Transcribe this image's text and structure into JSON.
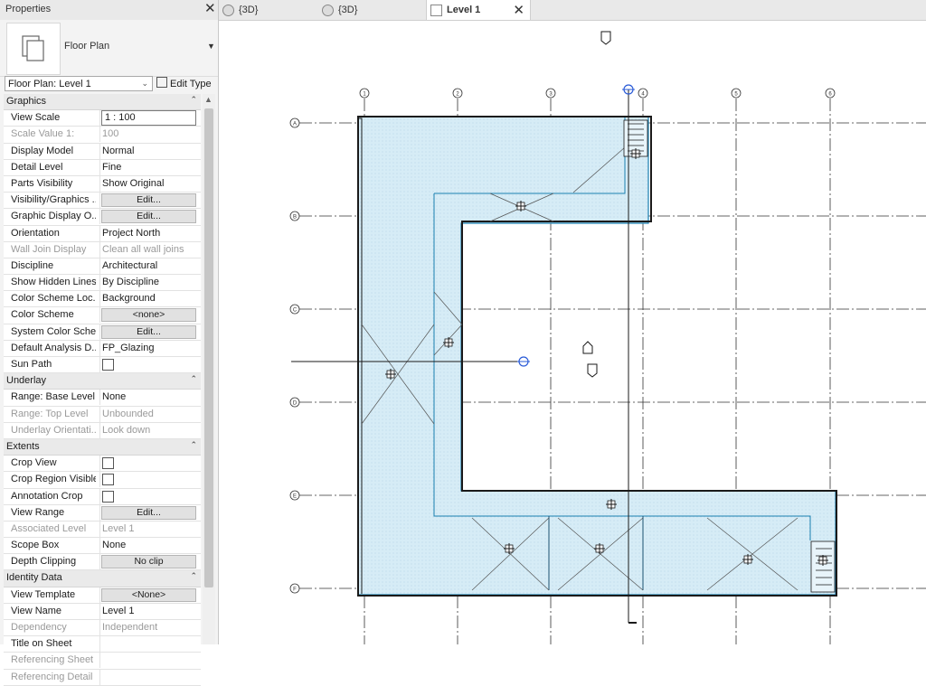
{
  "panel": {
    "title": "Properties",
    "type_name": "Floor Plan",
    "view_selector": "Floor Plan: Level 1",
    "edit_type": "Edit Type"
  },
  "sections": [
    {
      "name": "Graphics",
      "rows": [
        {
          "key": "View Scale",
          "value": "1 : 100",
          "kind": "input"
        },
        {
          "key": "Scale Value    1:",
          "value": "100",
          "kind": "disabled"
        },
        {
          "key": "Display Model",
          "value": "Normal",
          "kind": "text"
        },
        {
          "key": "Detail Level",
          "value": "Fine",
          "kind": "text"
        },
        {
          "key": "Parts Visibility",
          "value": "Show Original",
          "kind": "text"
        },
        {
          "key": "Visibility/Graphics ...",
          "value": "Edit...",
          "kind": "button"
        },
        {
          "key": "Graphic Display O...",
          "value": "Edit...",
          "kind": "button"
        },
        {
          "key": "Orientation",
          "value": "Project North",
          "kind": "text"
        },
        {
          "key": "Wall Join Display",
          "value": "Clean all wall joins",
          "kind": "disabled"
        },
        {
          "key": "Discipline",
          "value": "Architectural",
          "kind": "text"
        },
        {
          "key": "Show Hidden Lines",
          "value": "By Discipline",
          "kind": "text"
        },
        {
          "key": "Color Scheme Loc...",
          "value": "Background",
          "kind": "text"
        },
        {
          "key": "Color Scheme",
          "value": "<none>",
          "kind": "button"
        },
        {
          "key": "System Color Sche...",
          "value": "Edit...",
          "kind": "button"
        },
        {
          "key": "Default Analysis D...",
          "value": "FP_Glazing",
          "kind": "text"
        },
        {
          "key": "Sun Path",
          "value": "",
          "kind": "checkbox"
        }
      ]
    },
    {
      "name": "Underlay",
      "rows": [
        {
          "key": "Range: Base Level",
          "value": "None",
          "kind": "text"
        },
        {
          "key": "Range: Top Level",
          "value": "Unbounded",
          "kind": "disabled"
        },
        {
          "key": "Underlay Orientati...",
          "value": "Look down",
          "kind": "disabled"
        }
      ]
    },
    {
      "name": "Extents",
      "rows": [
        {
          "key": "Crop View",
          "value": "",
          "kind": "checkbox"
        },
        {
          "key": "Crop Region Visible",
          "value": "",
          "kind": "checkbox"
        },
        {
          "key": "Annotation Crop",
          "value": "",
          "kind": "checkbox"
        },
        {
          "key": "View Range",
          "value": "Edit...",
          "kind": "button"
        },
        {
          "key": "Associated Level",
          "value": "Level 1",
          "kind": "disabled"
        },
        {
          "key": "Scope Box",
          "value": "None",
          "kind": "text"
        },
        {
          "key": "Depth Clipping",
          "value": "No clip",
          "kind": "button"
        }
      ]
    },
    {
      "name": "Identity Data",
      "rows": [
        {
          "key": "View Template",
          "value": "<None>",
          "kind": "button"
        },
        {
          "key": "View Name",
          "value": "Level 1",
          "kind": "text"
        },
        {
          "key": "Dependency",
          "value": "Independent",
          "kind": "disabled"
        },
        {
          "key": "Title on Sheet",
          "value": "",
          "kind": "text"
        },
        {
          "key": "Referencing Sheet",
          "value": "",
          "kind": "disabled"
        },
        {
          "key": "Referencing Detail",
          "value": "",
          "kind": "disabled"
        }
      ]
    }
  ],
  "tabs": [
    {
      "label": "{3D}",
      "icon": "3d-view-icon"
    },
    {
      "label": "{3D}",
      "icon": "3d-view-icon"
    },
    {
      "label": "Level 1",
      "icon": "floor-plan-icon",
      "active": true
    }
  ],
  "grid_labels": {
    "vertical": [
      "1",
      "2",
      "3",
      "4",
      "5",
      "6"
    ],
    "horizontal": [
      "A",
      "B",
      "C",
      "D",
      "E",
      "F"
    ]
  },
  "colors": {
    "slab_fill": "#d6ecf6",
    "slab_edge": "#1a7fb0",
    "wall": "#1a1a1a"
  }
}
